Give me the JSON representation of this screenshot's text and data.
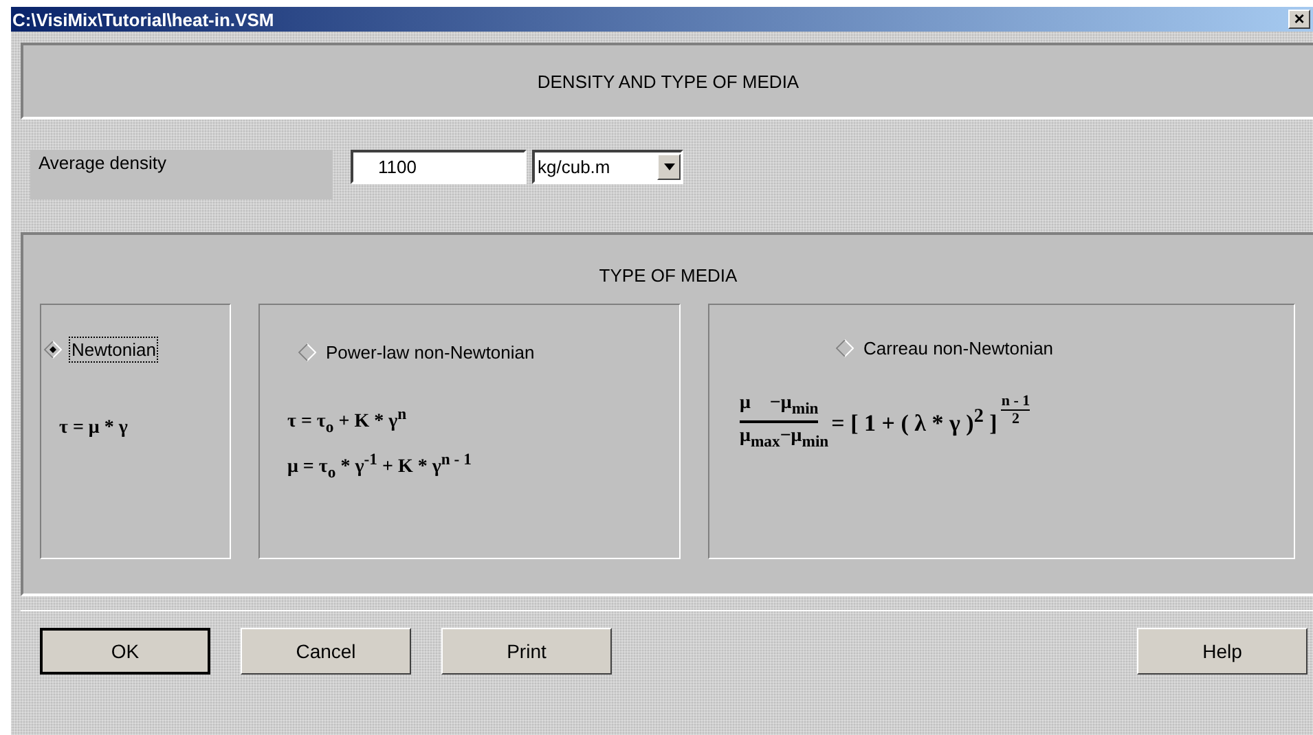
{
  "window": {
    "title": "C:\\VisiMix\\Tutorial\\heat-in.VSM",
    "close": "×"
  },
  "header": "DENSITY AND TYPE OF MEDIA",
  "density": {
    "label": "Average density",
    "value": "1100",
    "unit": "kg/cub.m"
  },
  "media": {
    "title": "TYPE OF MEDIA",
    "options": [
      {
        "kind": "lines",
        "label": "Newtonian",
        "selected": true,
        "focused": true,
        "lines": [
          "τ = μ * γ"
        ]
      },
      {
        "kind": "lines",
        "label": "Power-law non-Newtonian",
        "selected": false,
        "focused": false,
        "lines": [
          "τ = τ$_{o}$ + K * γ$^{n}$",
          "μ = τ$_{o}$ * γ$^{-1}$ + K * γ$^{n - 1}$"
        ]
      },
      {
        "kind": "fraction",
        "label": "Carreau non-Newtonian",
        "selected": false,
        "focused": false,
        "formula": {
          "numerator": "μ    −μ$_{min}$",
          "denominator": "μ$_{max}$−μ$_{min}$",
          "rhs": "= [ 1 + ( λ * γ )$^{2}$ ]",
          "exp_numerator": "n - 1",
          "exp_denominator": "2"
        }
      }
    ]
  },
  "buttons": [
    {
      "label": "OK",
      "default": true
    },
    {
      "label": "Cancel",
      "default": false
    },
    {
      "label": "Print",
      "default": false
    },
    {
      "label": "Help",
      "default": false
    }
  ]
}
